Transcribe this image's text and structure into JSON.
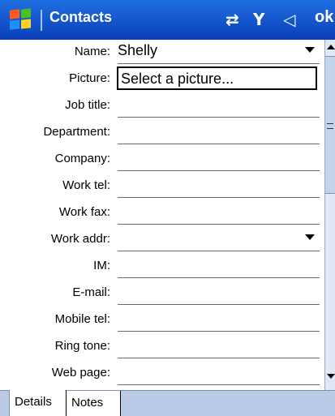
{
  "titlebar": {
    "title": "Contacts",
    "icons": [
      "windows-start-icon",
      "connectivity-icon",
      "signal-icon",
      "volume-icon"
    ],
    "ok_label": "ok"
  },
  "form": {
    "name": {
      "label": "Name:",
      "value": "Shelly"
    },
    "picture": {
      "label": "Picture:",
      "value": "Select a picture..."
    },
    "job_title": {
      "label": "Job title:",
      "value": ""
    },
    "department": {
      "label": "Department:",
      "value": ""
    },
    "company": {
      "label": "Company:",
      "value": ""
    },
    "work_tel": {
      "label": "Work tel:",
      "value": ""
    },
    "work_fax": {
      "label": "Work fax:",
      "value": ""
    },
    "work_addr": {
      "label": "Work addr:",
      "value": ""
    },
    "im": {
      "label": "IM:",
      "value": ""
    },
    "email": {
      "label": "E-mail:",
      "value": ""
    },
    "mobile_tel": {
      "label": "Mobile tel:",
      "value": ""
    },
    "ring_tone": {
      "label": "Ring tone:",
      "value": ""
    },
    "web_page": {
      "label": "Web page:",
      "value": ""
    }
  },
  "tabs": [
    {
      "label": "Details",
      "active": true
    },
    {
      "label": "Notes",
      "active": false
    }
  ]
}
